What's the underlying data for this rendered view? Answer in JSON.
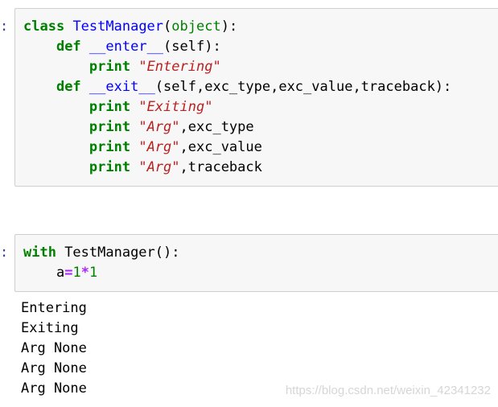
{
  "cells": [
    {
      "prompt": ":",
      "lines": [
        [
          [
            "kw",
            "class"
          ],
          [
            "p",
            " "
          ],
          [
            "fn",
            "TestManager"
          ],
          [
            "p",
            "("
          ],
          [
            "bi",
            "object"
          ],
          [
            "p",
            "):"
          ]
        ],
        [
          [
            "p",
            "    "
          ],
          [
            "kw",
            "def"
          ],
          [
            "p",
            " "
          ],
          [
            "fn",
            "__enter__"
          ],
          [
            "p",
            "(self):"
          ]
        ],
        [
          [
            "p",
            "        "
          ],
          [
            "kw",
            "print"
          ],
          [
            "p",
            " "
          ],
          [
            "str",
            "\"Entering\""
          ]
        ],
        [
          [
            "p",
            "    "
          ],
          [
            "kw",
            "def"
          ],
          [
            "p",
            " "
          ],
          [
            "fn",
            "__exit__"
          ],
          [
            "p",
            "(self,exc_type,exc_value,traceback):"
          ]
        ],
        [
          [
            "p",
            "        "
          ],
          [
            "kw",
            "print"
          ],
          [
            "p",
            " "
          ],
          [
            "str",
            "\"Exiting\""
          ]
        ],
        [
          [
            "p",
            "        "
          ],
          [
            "kw",
            "print"
          ],
          [
            "p",
            " "
          ],
          [
            "str",
            "\"Arg\""
          ],
          [
            "p",
            ",exc_type"
          ]
        ],
        [
          [
            "p",
            "        "
          ],
          [
            "kw",
            "print"
          ],
          [
            "p",
            " "
          ],
          [
            "str",
            "\"Arg\""
          ],
          [
            "p",
            ",exc_value"
          ]
        ],
        [
          [
            "p",
            "        "
          ],
          [
            "kw",
            "print"
          ],
          [
            "p",
            " "
          ],
          [
            "str",
            "\"Arg\""
          ],
          [
            "p",
            ",traceback"
          ]
        ]
      ]
    },
    {
      "prompt": ":",
      "lines": [
        [
          [
            "kw",
            "with"
          ],
          [
            "p",
            " TestManager():"
          ]
        ],
        [
          [
            "p",
            "    a"
          ],
          [
            "op",
            "="
          ],
          [
            "num",
            "1"
          ],
          [
            "op",
            "*"
          ],
          [
            "num",
            "1"
          ]
        ]
      ]
    }
  ],
  "output": {
    "lines": [
      "Entering",
      "Exiting",
      "Arg None",
      "Arg None",
      "Arg None"
    ]
  },
  "watermark": "https://blog.csdn.net/weixin_42341232",
  "colors": {
    "keyword": "#008000",
    "function": "#0000ff",
    "string": "#ba2121",
    "operator": "#aa22ff",
    "prompt": "#303f9f",
    "cell_background": "#f7f7f7",
    "cell_border": "#cfcfcf"
  }
}
